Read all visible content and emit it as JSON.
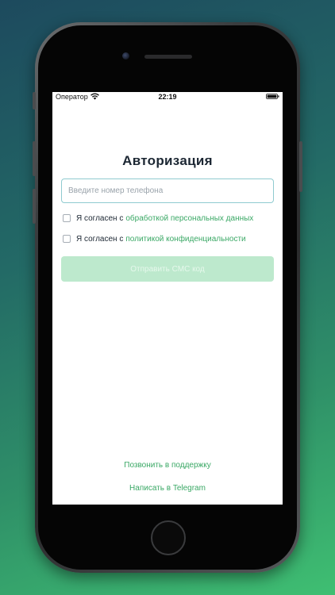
{
  "status_bar": {
    "carrier": "Оператор",
    "time": "22:19"
  },
  "auth": {
    "title": "Авторизация",
    "phone_placeholder": "Введите номер телефона",
    "consent_personal": {
      "prefix": "Я согласен с",
      "link": "обработкой персональных данных",
      "checked": false
    },
    "consent_privacy": {
      "prefix": "Я согласен с",
      "link": "политикой конфиденциальности",
      "checked": false
    },
    "send_button": "Отправить СМС код"
  },
  "footer": {
    "call_support": "Позвонить в поддержку",
    "telegram": "Написать в Telegram"
  },
  "colors": {
    "accent": "#3aa865",
    "button_disabled": "#bde9cd",
    "title": "#1c2733"
  }
}
